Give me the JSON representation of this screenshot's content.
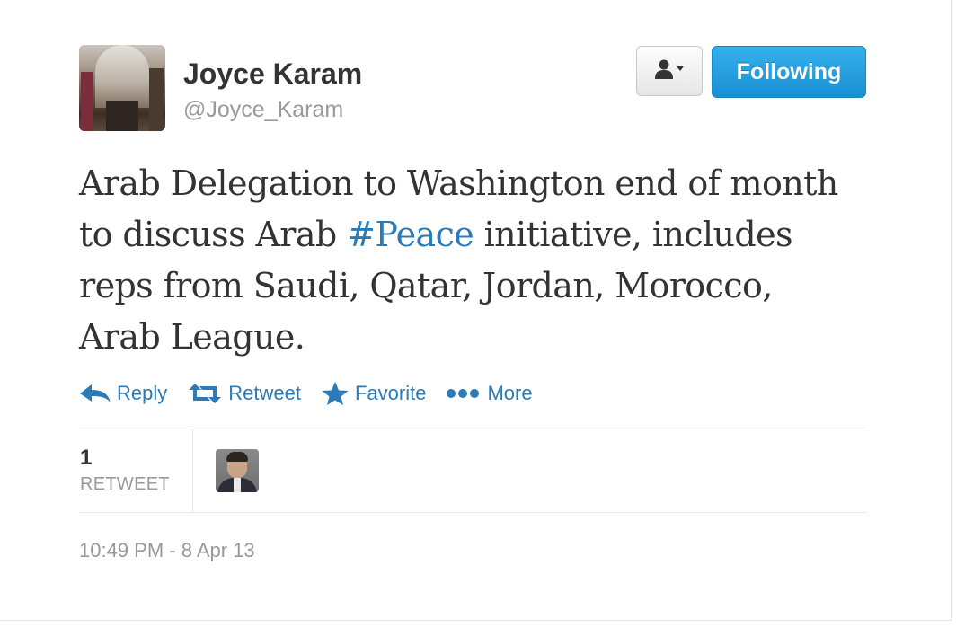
{
  "author": {
    "name": "Joyce Karam",
    "handle": "@Joyce_Karam"
  },
  "header": {
    "user_menu_icon": "person-dropdown-icon",
    "follow_label": "Following"
  },
  "tweet": {
    "text_before_hashtag": "Arab Delegation to Washington end of month to discuss Arab ",
    "hashtag": "#Peace",
    "text_after_hashtag": " initiative, includes reps from Saudi, Qatar, Jordan, Morocco, Arab League."
  },
  "actions": [
    {
      "label": "Reply",
      "icon": "reply-icon"
    },
    {
      "label": "Retweet",
      "icon": "retweet-icon"
    },
    {
      "label": "Favorite",
      "icon": "star-icon"
    },
    {
      "label": "More",
      "icon": "more-dots-icon"
    }
  ],
  "stats": {
    "retweet_count": "1",
    "retweet_label": "RETWEET"
  },
  "timestamp": "10:49 PM - 8 Apr 13",
  "colors": {
    "link": "#2b7bb9",
    "follow_button": "#1b8fd3",
    "muted_text": "#999999"
  }
}
